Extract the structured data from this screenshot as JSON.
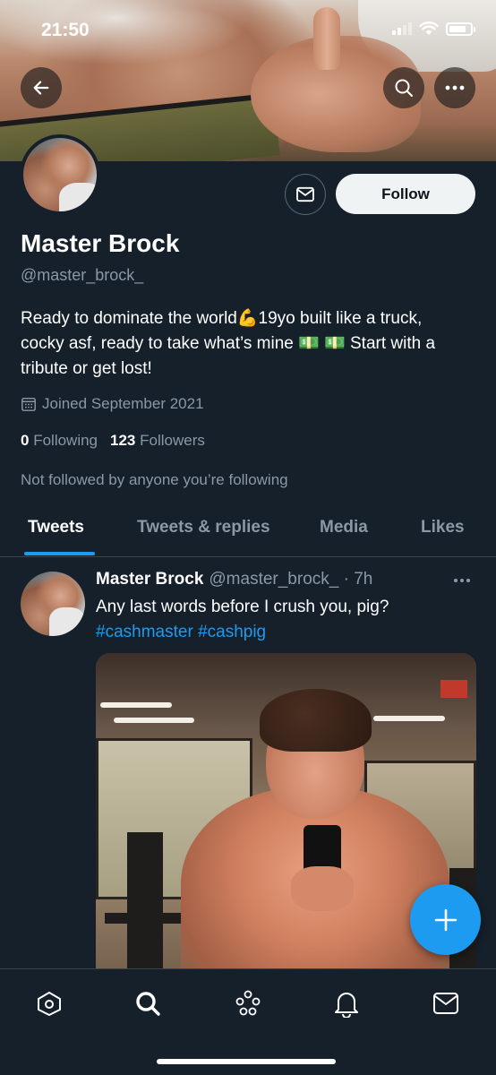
{
  "status_bar": {
    "time": "21:50"
  },
  "profile": {
    "display_name": "Master Brock",
    "handle": "@master_brock_",
    "bio": "Ready to dominate the world💪19yo built like a truck, cocky asf, ready to take what’s mine 💵 💵 Start with a tribute or get lost!",
    "joined": "Joined September 2021",
    "following_count": "0",
    "following_label": "Following",
    "followers_count": "123",
    "followers_label": "Followers",
    "not_followed_text": "Not followed by anyone you’re following",
    "follow_button_label": "Follow"
  },
  "tabs": [
    {
      "label": "Tweets",
      "active": true
    },
    {
      "label": "Tweets & replies",
      "active": false
    },
    {
      "label": "Media",
      "active": false
    },
    {
      "label": "Likes",
      "active": false
    }
  ],
  "tweet": {
    "name": "Master Brock",
    "meta": "@master_brock_ · 7h",
    "text": "Any last words before I crush you, pig?",
    "hashtags": [
      "#cashmaster",
      "#cashpig"
    ]
  },
  "icons": {
    "back": "arrow-left-icon",
    "search": "search-icon",
    "more": "more-horizontal-icon",
    "message": "envelope-icon",
    "compose": "plus-icon",
    "nav": [
      "home-icon",
      "search-icon",
      "spaces-icon",
      "bell-icon",
      "envelope-icon"
    ]
  },
  "colors": {
    "background": "#15202b",
    "accent": "#1d9bf0",
    "secondary_text": "#8b98a5",
    "divider": "#38444d"
  }
}
